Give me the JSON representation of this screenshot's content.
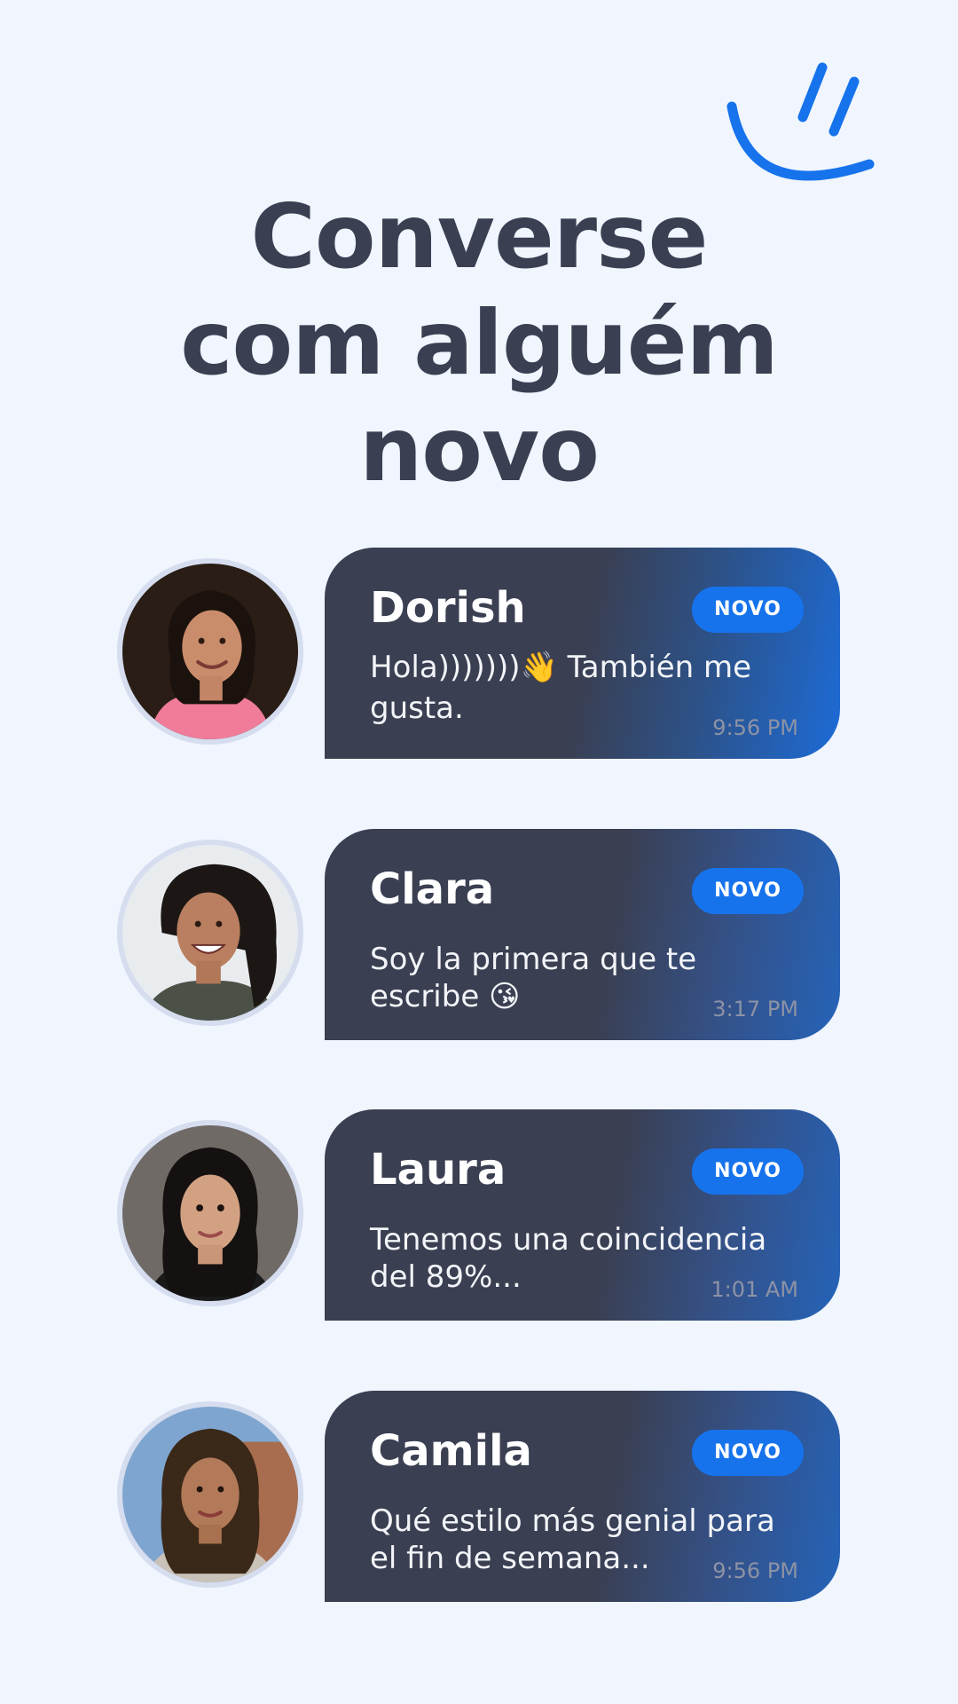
{
  "headline": {
    "line1": "Converse",
    "line2": "com alguém",
    "line3": "novo"
  },
  "accent_color": "#1673ec",
  "chats": [
    {
      "name": "Dorish",
      "badge": "NOVO",
      "message": "Hola)))))))👋 También me gusta.",
      "time": "9:56 PM"
    },
    {
      "name": "Clara",
      "badge": "NOVO",
      "message": "Soy la primera que te escribe 😘",
      "time": "3:17 PM"
    },
    {
      "name": "Laura",
      "badge": "NOVO",
      "message": "Tenemos una coincidencia del 89%...",
      "time": "1:01 AM"
    },
    {
      "name": "Camila",
      "badge": "NOVO",
      "message": "Qué estilo más genial para el fin de semana...",
      "time": "9:56 PM"
    }
  ]
}
